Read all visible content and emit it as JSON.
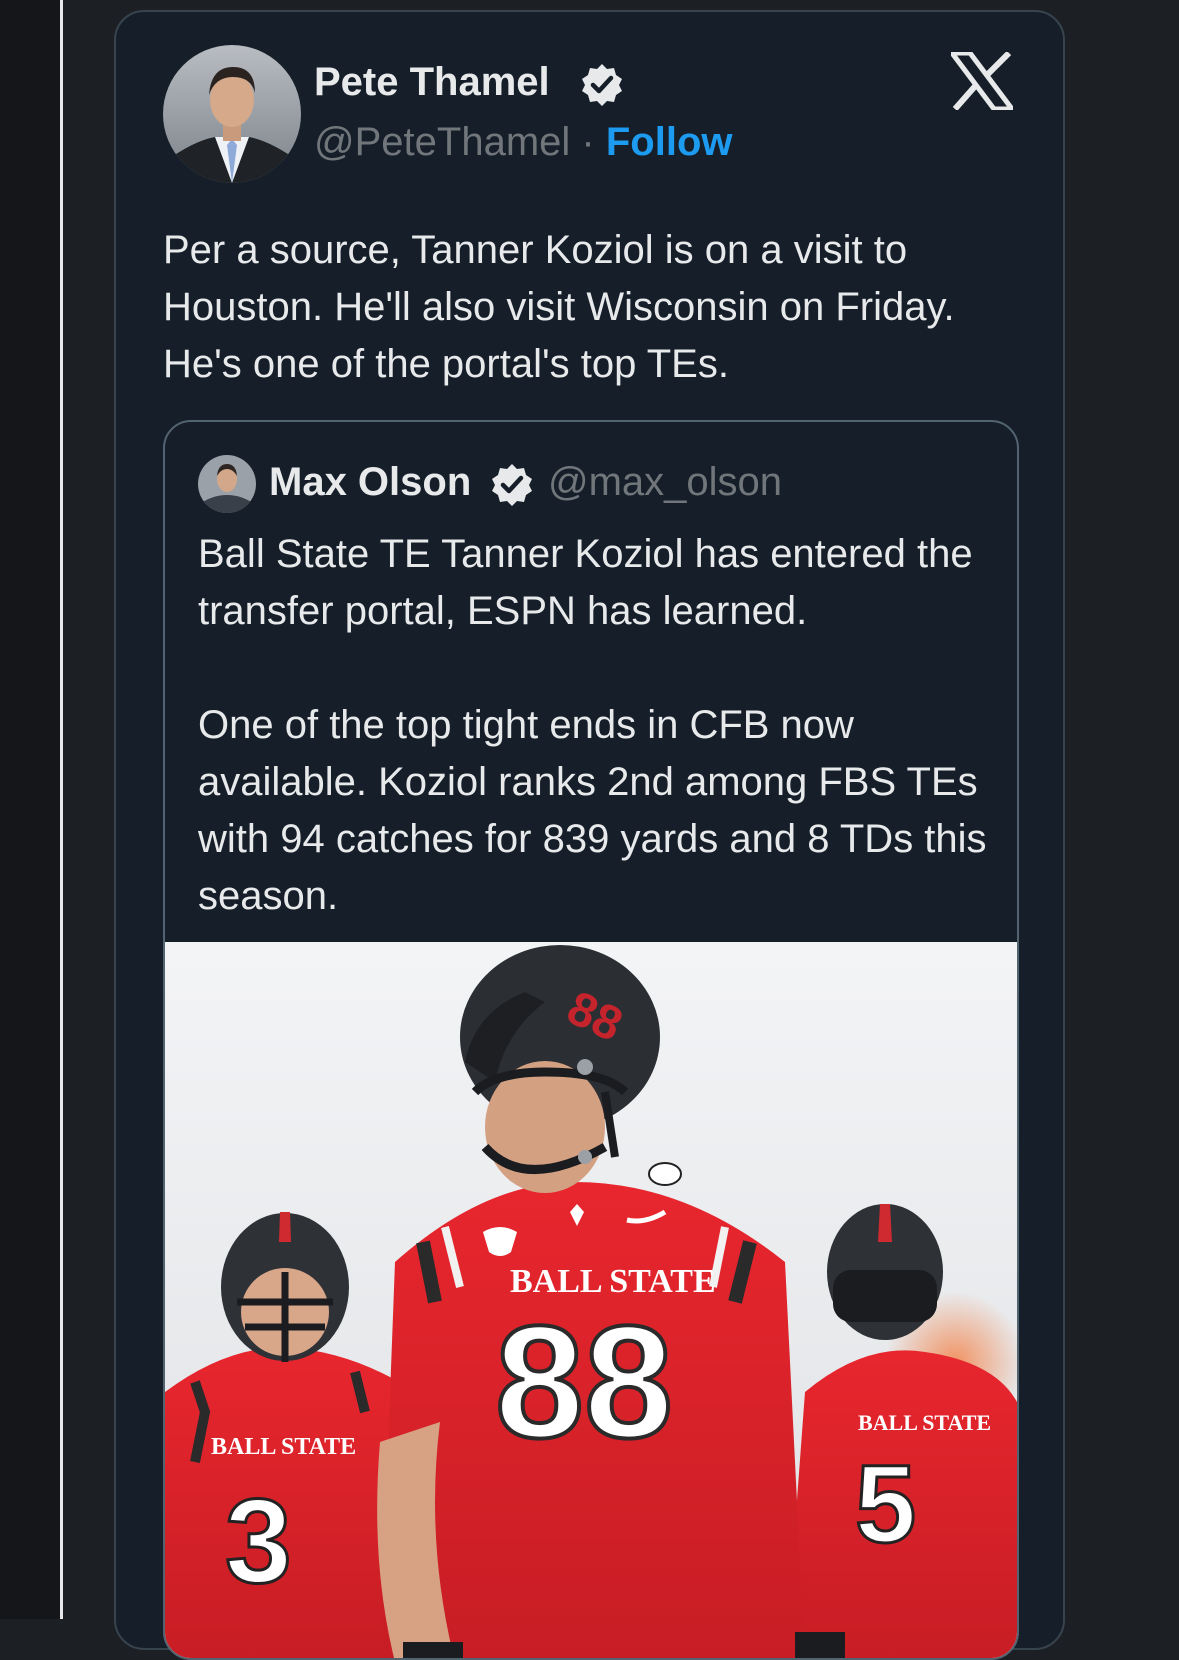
{
  "tweet": {
    "author_name": "Pete Thamel",
    "author_handle": "@PeteThamel",
    "separator": "·",
    "follow_label": "Follow",
    "text": "Per a source, Tanner Koziol is on a visit to Houston. He'll also visit Wisconsin on Friday. He's one of the portal's top TEs.",
    "platform_icon": "x-logo-icon"
  },
  "quoted_tweet": {
    "author_name": "Max Olson",
    "author_handle": "@max_olson",
    "paragraphs": [
      "Ball State TE Tanner Koziol has entered the transfer portal, ESPN has learned.",
      "One of the top tight ends in CFB now available. Koziol ranks 2nd among FBS TEs with 94 catches for 839 yards and 8 TDs this season."
    ],
    "media": {
      "jersey_text": "BALL STATE",
      "main_number": "88",
      "left_number": "3",
      "right_number": "5",
      "helmet_number": "88"
    }
  },
  "colors": {
    "card_bg": "#151e29",
    "text": "#e7e9ea",
    "muted": "#71767b",
    "accent": "#1d9bf0",
    "jersey_red": "#e0242b"
  }
}
